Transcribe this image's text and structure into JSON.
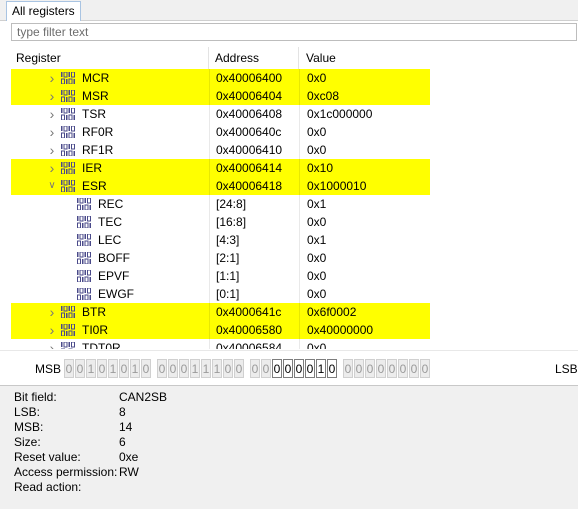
{
  "tabs": [
    {
      "label": "All registers"
    }
  ],
  "filter": {
    "placeholder": "type filter text",
    "value": ""
  },
  "table": {
    "columns": [
      "Register",
      "Address",
      "Value"
    ],
    "highlight_color": "#ffff00",
    "rows": [
      {
        "name": "MCR",
        "address": "0x40006400",
        "value": "0x0",
        "highlighted": true,
        "level": 0,
        "expand": "collapsed"
      },
      {
        "name": "MSR",
        "address": "0x40006404",
        "value": "0xc08",
        "highlighted": true,
        "level": 0,
        "expand": "collapsed"
      },
      {
        "name": "TSR",
        "address": "0x40006408",
        "value": "0x1c000000",
        "highlighted": false,
        "level": 0,
        "expand": "collapsed"
      },
      {
        "name": "RF0R",
        "address": "0x4000640c",
        "value": "0x0",
        "highlighted": false,
        "level": 0,
        "expand": "collapsed"
      },
      {
        "name": "RF1R",
        "address": "0x40006410",
        "value": "0x0",
        "highlighted": false,
        "level": 0,
        "expand": "collapsed"
      },
      {
        "name": "IER",
        "address": "0x40006414",
        "value": "0x10",
        "highlighted": true,
        "level": 0,
        "expand": "collapsed"
      },
      {
        "name": "ESR",
        "address": "0x40006418",
        "value": "0x1000010",
        "highlighted": true,
        "level": 0,
        "expand": "expanded"
      },
      {
        "name": "REC",
        "address": "[24:8]",
        "value": "0x1",
        "highlighted": false,
        "level": 1,
        "expand": "none"
      },
      {
        "name": "TEC",
        "address": "[16:8]",
        "value": "0x0",
        "highlighted": false,
        "level": 1,
        "expand": "none"
      },
      {
        "name": "LEC",
        "address": "[4:3]",
        "value": "0x1",
        "highlighted": false,
        "level": 1,
        "expand": "none"
      },
      {
        "name": "BOFF",
        "address": "[2:1]",
        "value": "0x0",
        "highlighted": false,
        "level": 1,
        "expand": "none"
      },
      {
        "name": "EPVF",
        "address": "[1:1]",
        "value": "0x0",
        "highlighted": false,
        "level": 1,
        "expand": "none"
      },
      {
        "name": "EWGF",
        "address": "[0:1]",
        "value": "0x0",
        "highlighted": false,
        "level": 1,
        "expand": "none"
      },
      {
        "name": "BTR",
        "address": "0x4000641c",
        "value": "0x6f0002",
        "highlighted": true,
        "level": 0,
        "expand": "collapsed"
      },
      {
        "name": "TI0R",
        "address": "0x40006580",
        "value": "0x40000000",
        "highlighted": true,
        "level": 0,
        "expand": "collapsed"
      },
      {
        "name": "TDT0R",
        "address": "0x40006584",
        "value": "0x0",
        "highlighted": false,
        "level": 0,
        "expand": "collapsed"
      }
    ]
  },
  "bits": {
    "msb_label": "MSB",
    "lsb_label": "LSB",
    "values": [
      "0",
      "0",
      "1",
      "0",
      "1",
      "0",
      "1",
      "0",
      "0",
      "0",
      "0",
      "1",
      "1",
      "1",
      "0",
      "0",
      "0",
      "0",
      "0",
      "0",
      "0",
      "0",
      "1",
      "0",
      "0",
      "0",
      "0",
      "0",
      "0",
      "0",
      "0",
      "0"
    ],
    "active": [
      false,
      false,
      false,
      false,
      false,
      false,
      false,
      false,
      false,
      false,
      false,
      false,
      false,
      false,
      false,
      false,
      false,
      false,
      true,
      true,
      true,
      true,
      true,
      true,
      false,
      false,
      false,
      false,
      false,
      false,
      false,
      false
    ]
  },
  "info": [
    {
      "label": "Bit field:",
      "value": "CAN2SB"
    },
    {
      "label": "LSB:",
      "value": "8"
    },
    {
      "label": "MSB:",
      "value": "14"
    },
    {
      "label": "Size:",
      "value": "6"
    },
    {
      "label": "Reset value:",
      "value": "0xe"
    },
    {
      "label": "Access permission:",
      "value": "RW"
    },
    {
      "label": "Read action:",
      "value": ""
    }
  ]
}
